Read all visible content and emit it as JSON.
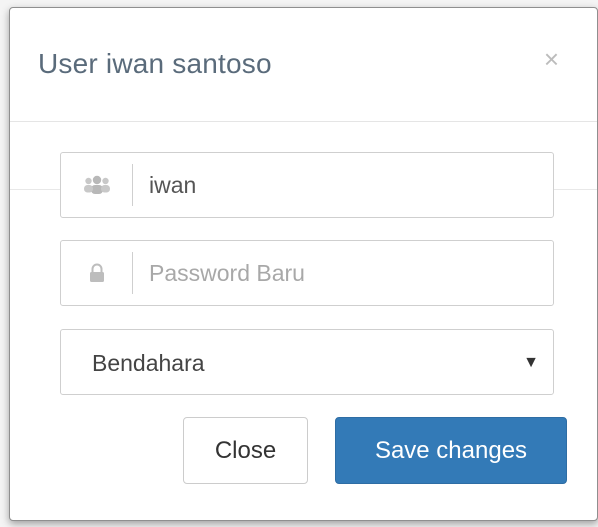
{
  "modal": {
    "title": "User iwan santoso",
    "close_glyph": "×"
  },
  "form": {
    "username": {
      "icon": "users-icon",
      "value": "iwan"
    },
    "password": {
      "icon": "lock-icon",
      "placeholder": "Password Baru",
      "value": ""
    },
    "role": {
      "selected": "Bendahara",
      "caret": "▼"
    }
  },
  "footer": {
    "close_label": "Close",
    "save_label": "Save changes"
  },
  "colors": {
    "title": "#5a6b7b",
    "primary": "#337ab7",
    "icon": "#b8b8b8"
  }
}
